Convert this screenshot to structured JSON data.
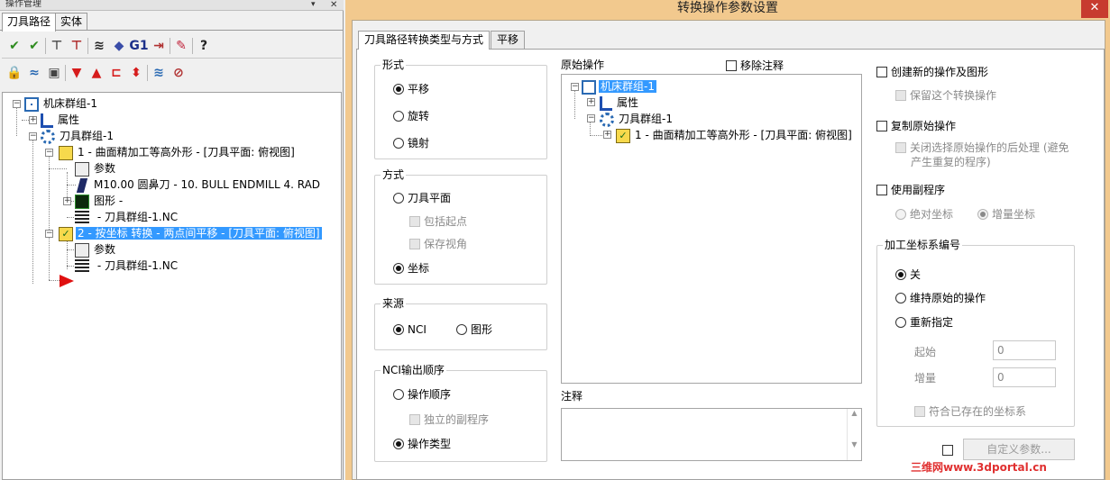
{
  "left_panel": {
    "title": "操作管理",
    "pin_glyph": "▾",
    "tabs": [
      "刀具路径",
      "实体"
    ],
    "toolbar_row1": [
      {
        "icon": "select-all-icon",
        "glyph": "✔",
        "color": "#2e8b1f"
      },
      {
        "icon": "regenerate-icon",
        "glyph": "✔",
        "color": "#2e8b1f"
      },
      {
        "icon": "regen-dirty-icon",
        "glyph": "⊤",
        "color": "#555"
      },
      {
        "icon": "remove-toolpath-icon",
        "glyph": "⊤",
        "color": "#b03030"
      },
      {
        "icon": "backplot-icon",
        "glyph": "≋",
        "color": "#222"
      },
      {
        "icon": "verify-icon",
        "glyph": "◆",
        "color": "#3a4da8"
      },
      {
        "icon": "post-g1-icon",
        "glyph": "G1",
        "color": "#1b2f8a"
      },
      {
        "icon": "high-speed-icon",
        "glyph": "⇥",
        "color": "#b03030"
      },
      {
        "icon": "delete-icon",
        "glyph": "✎",
        "color": "#c0223a"
      },
      {
        "icon": "help-icon",
        "glyph": "?",
        "color": "#222"
      }
    ],
    "toolbar_row2": [
      {
        "icon": "lock-icon",
        "glyph": "🔒",
        "color": "#c78a00"
      },
      {
        "icon": "toggle-display-icon",
        "glyph": "≈",
        "color": "#2a6ab3"
      },
      {
        "icon": "skip-post-icon",
        "glyph": "▣",
        "color": "#444"
      },
      {
        "icon": "move-down-icon",
        "glyph": "▼",
        "color": "#d61c1c"
      },
      {
        "icon": "move-up-icon",
        "glyph": "▲",
        "color": "#d61c1c"
      },
      {
        "icon": "insert-after-icon",
        "glyph": "⊏",
        "color": "#d61c1c"
      },
      {
        "icon": "insert-arrow-icon",
        "glyph": "⬍",
        "color": "#d61c1c"
      },
      {
        "icon": "wave-icon",
        "glyph": "≋",
        "color": "#2a6ab3"
      },
      {
        "icon": "links-icon",
        "glyph": "⊘",
        "color": "#b03030"
      }
    ],
    "tree": [
      {
        "label": "机床群组-1",
        "icon": "machine-group-icon"
      },
      {
        "label": "属性",
        "icon": "properties-icon"
      },
      {
        "label": "刀具群组-1",
        "icon": "toolpath-group-icon"
      },
      {
        "label": "1 - 曲面精加工等高外形 - [刀具平面: 俯视图]",
        "icon": "open-folder-icon"
      },
      {
        "label": "参数",
        "icon": "parameters-icon"
      },
      {
        "label": "M10.00 圆鼻刀 -     10. BULL ENDMILL 4. RAD",
        "icon": "tool-icon"
      },
      {
        "label": "图形 -",
        "icon": "geometry-icon"
      },
      {
        "label": " - 刀具群组-1.NC",
        "icon": "nc-file-icon"
      },
      {
        "label": "2 - 按坐标 转换 - 两点间平移 - [刀具平面: 俯视图]",
        "icon": "open-folder-check-icon"
      },
      {
        "label": "参数",
        "icon": "parameters-icon"
      },
      {
        "label": " - 刀具群组-1.NC",
        "icon": "nc-file-icon"
      }
    ]
  },
  "dialog": {
    "title": "转换操作参数设置",
    "close_glyph": "✕",
    "tabs": [
      "刀具路径转换类型与方式",
      "平移"
    ],
    "form_group": {
      "title": "形式",
      "options": [
        "平移",
        "旋转",
        "镜射"
      ],
      "selected": 0
    },
    "method_group": {
      "title": "方式",
      "option1": "刀具平面",
      "sub1": "包括起点",
      "sub2": "保存视角",
      "option2": "坐标",
      "selected": "坐标"
    },
    "source_group": {
      "title": "来源",
      "options": [
        "NCI",
        "图形"
      ],
      "selected": 0
    },
    "nci_group": {
      "title": "NCI输出顺序",
      "option1": "操作顺序",
      "sub1": "独立的副程序",
      "option2": "操作类型",
      "selected": "操作类型"
    },
    "original_ops": {
      "label": "原始操作",
      "remove_comment": "移除注释",
      "tree": [
        {
          "label": "机床群组-1",
          "icon": "machine-group-icon"
        },
        {
          "label": "属性",
          "icon": "properties-icon"
        },
        {
          "label": "刀具群组-1",
          "icon": "toolpath-group-icon"
        },
        {
          "label": "1 - 曲面精加工等高外形 - [刀具平面: 俯视图]",
          "icon": "selected-operation-icon"
        }
      ]
    },
    "comment": {
      "label": "注释",
      "value": ""
    },
    "right": {
      "create_new": "创建新的操作及图形",
      "keep_op": "保留这个转换操作",
      "copy_orig": "复制原始操作",
      "close_post_l1": "关闭选择原始操作的后处理 (避免",
      "close_post_l2": "产生重复的程序)",
      "use_sub": "使用副程序",
      "abs": "绝对坐标",
      "inc": "增量坐标",
      "wcs_title": "加工坐标系编号",
      "wcs_opts": [
        "关",
        "维持原始的操作",
        "重新指定"
      ],
      "wcs_selected": 0,
      "start_label": "起始",
      "start_value": "0",
      "incr_label": "增量",
      "incr_value": "0",
      "match": "符合已存在的坐标系",
      "custom": "自定义参数..."
    }
  },
  "watermark": "三维网www.3dportal.cn"
}
